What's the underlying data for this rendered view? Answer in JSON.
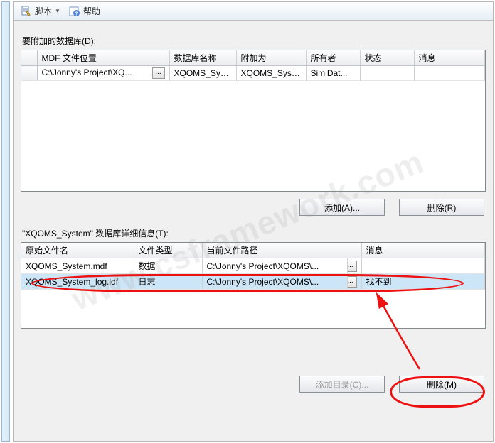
{
  "toolbar": {
    "script_label": "脚本",
    "help_label": "帮助"
  },
  "top_section": {
    "label": "要附加的数据库(D):",
    "columns": {
      "selector": "",
      "mdf": "MDF 文件位置",
      "db_name": "数据库名称",
      "attach_as": "附加为",
      "owner": "所有者",
      "status": "状态",
      "message": "消息"
    },
    "rows": [
      {
        "mdf": "C:\\Jonny's Project\\XQ...",
        "db_name": "XQOMS_System",
        "attach_as": "XQOMS_System",
        "owner": "SimiDat...",
        "status": "",
        "message": ""
      }
    ],
    "add_btn": "添加(A)...",
    "remove_btn": "删除(R)"
  },
  "bottom_section": {
    "label": "\"XQOMS_System\" 数据库详细信息(T):",
    "columns": {
      "orig_name": "原始文件名",
      "file_type": "文件类型",
      "current_path": "当前文件路径",
      "message": "消息"
    },
    "rows": [
      {
        "orig_name": "XQOMS_System.mdf",
        "file_type": "数据",
        "current_path": "C:\\Jonny's Project\\XQOMS\\...",
        "message": ""
      },
      {
        "orig_name": "XQOMS_System_log.ldf",
        "file_type": "日志",
        "current_path": "C:\\Jonny's Project\\XQOMS\\...",
        "message": "找不到"
      }
    ],
    "add_dir_btn": "添加目录(C)...",
    "remove_btn": "删除(M)"
  },
  "watermark": "www.csframework.com"
}
